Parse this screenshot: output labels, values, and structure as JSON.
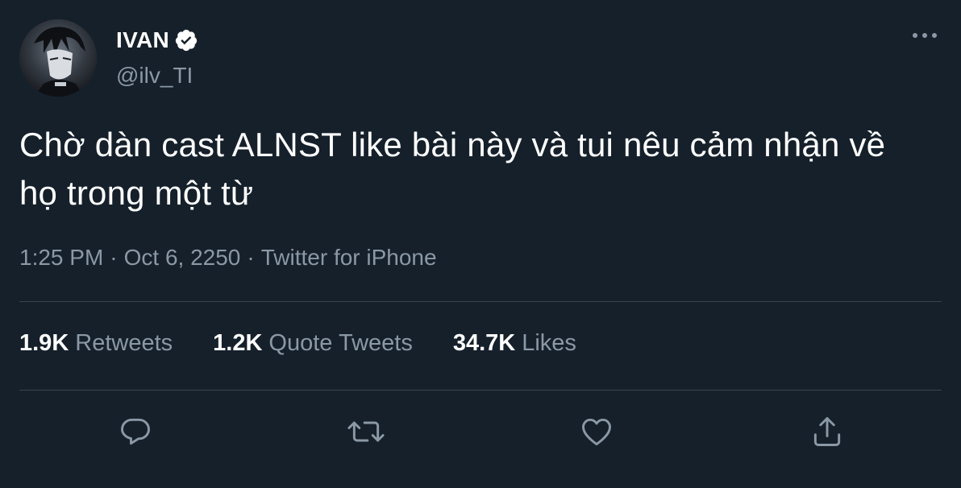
{
  "author": {
    "display_name": "IVAN",
    "handle": "@ilv_TI",
    "verified": true
  },
  "tweet": {
    "text": "Chờ dàn cast ALNST like bài này và tui nêu cảm nhận về họ trong một từ",
    "time": "1:25 PM",
    "date": "Oct 6, 2250",
    "source": "Twitter for iPhone",
    "separator": "·"
  },
  "stats": [
    {
      "count": "1.9K",
      "label": "Retweets"
    },
    {
      "count": "1.2K",
      "label": "Quote Tweets"
    },
    {
      "count": "34.7K",
      "label": "Likes"
    }
  ],
  "actions": [
    {
      "name": "reply",
      "icon": "reply-icon"
    },
    {
      "name": "retweet",
      "icon": "retweet-icon"
    },
    {
      "name": "like",
      "icon": "heart-icon"
    },
    {
      "name": "share",
      "icon": "share-icon"
    }
  ],
  "colors": {
    "background": "#15202b",
    "primary_text": "#ffffff",
    "secondary_text": "#8b98a5",
    "divider": "#38444d"
  }
}
